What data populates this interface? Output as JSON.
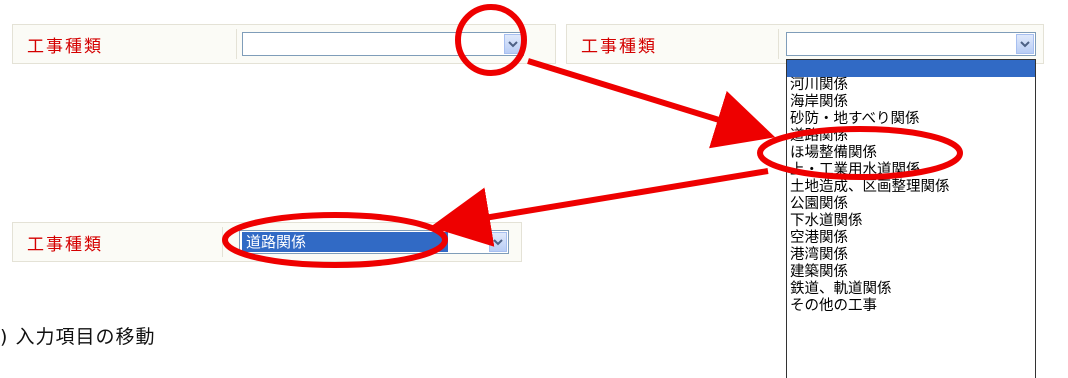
{
  "field_label": "工事種類",
  "colors": {
    "label_red": "#d40000",
    "annotation_red": "#ee0000",
    "selection_blue": "#316ac5"
  },
  "example1": {
    "select_value": ""
  },
  "example2": {
    "select_value": "",
    "options": [
      "",
      "河川関係",
      "海岸関係",
      "砂防・地すべり関係",
      "道路関係",
      "ほ場整備関係",
      "上・工業用水道関係",
      "土地造成、区画整理関係",
      "公園関係",
      "下水道関係",
      "空港関係",
      "港湾関係",
      "建築関係",
      "鉄道、軌道関係",
      "その他の工事"
    ],
    "highlighted_index": 0
  },
  "example3": {
    "select_value": "道路関係"
  },
  "caption": ") 入力項目の移動",
  "icons": {
    "dropdown_arrow": "chevron-down-icon"
  }
}
